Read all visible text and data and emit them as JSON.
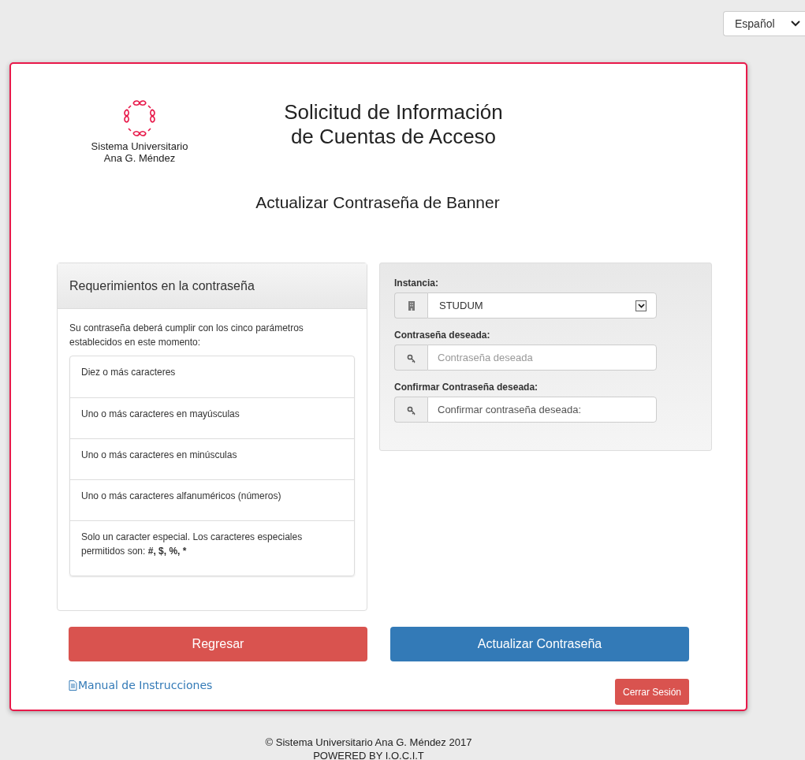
{
  "language_select": {
    "value": "Español"
  },
  "logo": {
    "caption": [
      "Sistema Universitario",
      "Ana G. Méndez"
    ]
  },
  "title": [
    "Solicitud de Información",
    "de Cuentas de Acceso"
  ],
  "subtitle": "Actualizar Contraseña de Banner",
  "requirements": {
    "heading": "Requerimientos en la contraseña",
    "intro": "Su contraseña deberá cumplir con los cinco parámetros establecidos en este momento:",
    "items": [
      {
        "text": "Diez o más caracteres"
      },
      {
        "text": "Uno o más caracteres en mayúsculas"
      },
      {
        "text": "Uno o más caracteres en minúsculas"
      },
      {
        "text": "Uno o más caracteres alfanuméricos (números)"
      },
      {
        "text": "Solo un caracter especial. Los caracteres especiales permitidos son: ",
        "emphasis": "#, $, %, *"
      }
    ]
  },
  "form": {
    "fields": [
      {
        "kind": "select",
        "label": "Instancia:",
        "value": "STUDUM"
      },
      {
        "kind": "password",
        "label": "Contraseña deseada:",
        "placeholder": "Contraseña deseada"
      },
      {
        "kind": "password",
        "label": "Confirmar Contraseña deseada:",
        "value": "Confirmar contraseña deseada:"
      }
    ]
  },
  "actions": {
    "back": "Regresar",
    "submit": "Actualizar Contraseña"
  },
  "manual_link": "Manual de Instrucciones",
  "logout": "Cerrar Sesión",
  "footer": [
    "© Sistema Universitario Ana G. Méndez 2017",
    "POWERED BY I.O.C.I.T"
  ]
}
